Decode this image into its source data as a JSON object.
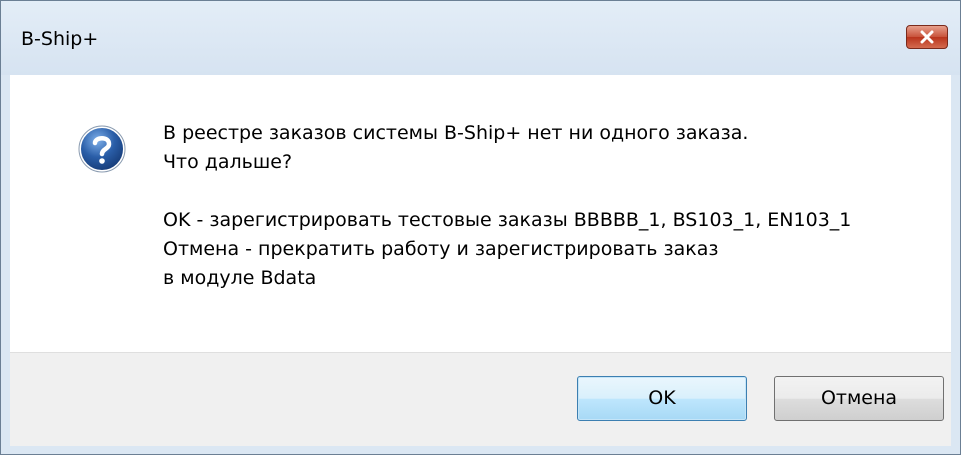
{
  "window": {
    "title": "B-Ship+"
  },
  "dialog": {
    "icon": "question-icon",
    "message_lines": [
      "В реестре заказов системы B-Ship+ нет ни одного заказа.",
      "Что дальше?",
      "",
      "OK - зарегистрировать тестовые заказы BBBBB_1, BS103_1, EN103_1",
      "Отмена - прекратить работу и зарегистрировать заказ",
      "в модуле Bdata"
    ]
  },
  "buttons": {
    "ok_label": "OK",
    "cancel_label": "Отмена"
  },
  "colors": {
    "close_button": "#c8523a",
    "question_icon": "#2a5ea8",
    "default_button_border": "#3c7fb1"
  }
}
